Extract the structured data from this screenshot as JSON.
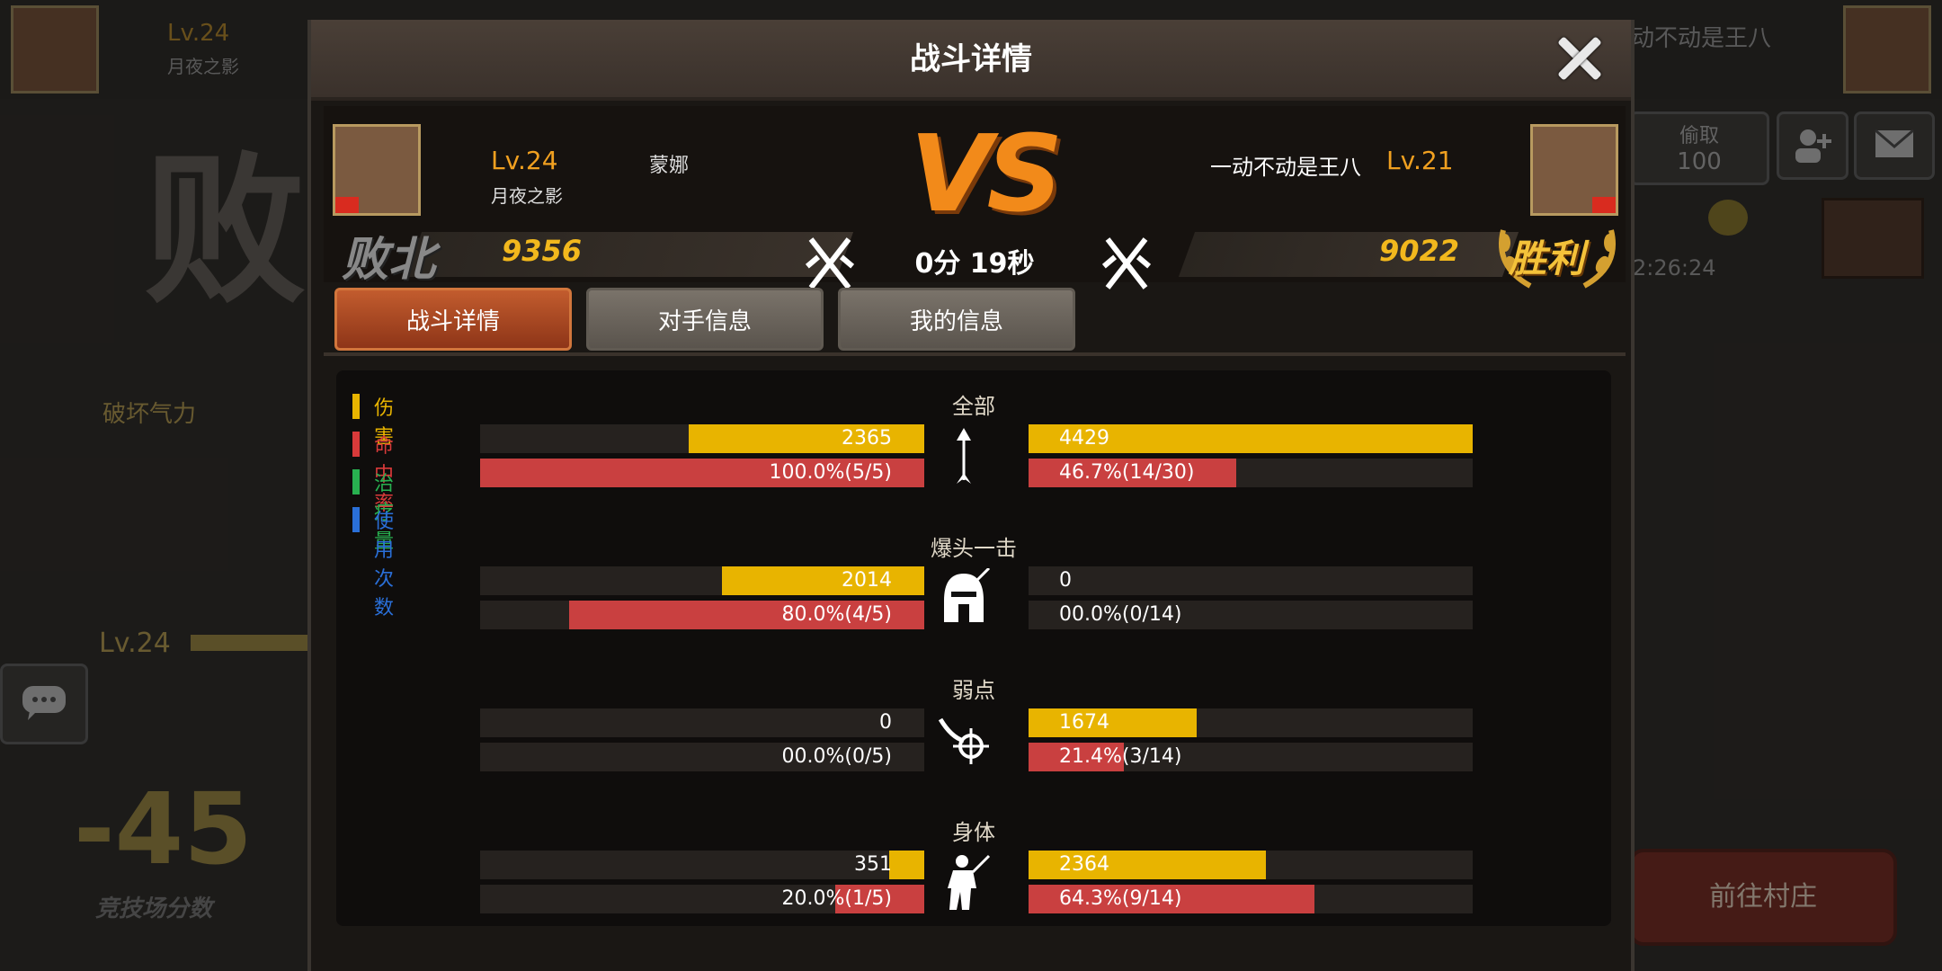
{
  "background": {
    "left_player": {
      "level": "Lv.24",
      "name": "月夜之影"
    },
    "right_player": {
      "name": "动不动是王八"
    },
    "defeat_big": "败",
    "destroy_qi": "破坏气力",
    "lv_label": "Lv.24",
    "arena_score_delta": "-45",
    "arena_score_label": "竞技场分数",
    "steal_label": "偷取",
    "steal_value": "100",
    "timer": "2:26:24",
    "goto_village": "前往村庄"
  },
  "modal": {
    "title": "战斗详情",
    "left": {
      "level": "Lv.24",
      "title_name": "蒙娜",
      "name": "月夜之影",
      "score": "9356",
      "result": "败北"
    },
    "right": {
      "level": "Lv.21",
      "name": "一动不动是王八",
      "score": "9022",
      "result": "胜利"
    },
    "vs": "VS",
    "duration": "0分 19秒",
    "tabs": [
      {
        "label": "战斗详情",
        "active": true
      },
      {
        "label": "对手信息",
        "active": false
      },
      {
        "label": "我的信息",
        "active": false
      }
    ],
    "legend": [
      {
        "label": "伤害",
        "color": "#e8b400"
      },
      {
        "label": "命中率",
        "color": "#d83a3a"
      },
      {
        "label": "治疗量",
        "color": "#28b050"
      },
      {
        "label": "使用次数",
        "color": "#2a6fd8"
      }
    ],
    "colors": {
      "damage": "#e8b400",
      "hit": "#c94040"
    },
    "sections": [
      {
        "title": "全部",
        "icon": "arrow-icon",
        "left_damage": "2365",
        "left_damage_frac": 0.53,
        "left_hit": "100.0%(5/5)",
        "left_hit_frac": 1.0,
        "right_damage": "4429",
        "right_damage_frac": 1.0,
        "right_hit": "46.7%(14/30)",
        "right_hit_frac": 0.467
      },
      {
        "title": "爆头一击",
        "icon": "helmet-icon",
        "left_damage": "2014",
        "left_damage_frac": 0.455,
        "left_hit": "80.0%(4/5)",
        "left_hit_frac": 0.8,
        "right_damage": "0",
        "right_damage_frac": 0,
        "right_hit": "00.0%(0/14)",
        "right_hit_frac": 0
      },
      {
        "title": "弱点",
        "icon": "crosshair-icon",
        "left_damage": "0",
        "left_damage_frac": 0,
        "left_hit": "00.0%(0/5)",
        "left_hit_frac": 0,
        "right_damage": "1674",
        "right_damage_frac": 0.378,
        "right_hit": "21.4%(3/14)",
        "right_hit_frac": 0.214
      },
      {
        "title": "身体",
        "icon": "body-icon",
        "left_damage": "351",
        "left_damage_frac": 0.079,
        "left_hit": "20.0%(1/5)",
        "left_hit_frac": 0.2,
        "right_damage": "2364",
        "right_damage_frac": 0.534,
        "right_hit": "64.3%(9/14)",
        "right_hit_frac": 0.643
      }
    ]
  }
}
